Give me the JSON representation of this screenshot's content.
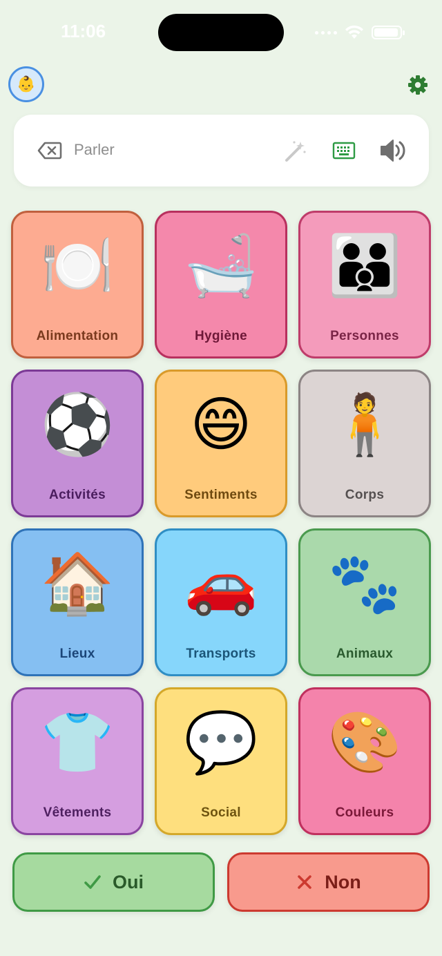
{
  "status": {
    "time": "11:06"
  },
  "header": {
    "avatar_emoji": "👶",
    "settings_icon": "gear-icon"
  },
  "speak_bar": {
    "placeholder": "Parler"
  },
  "categories": [
    {
      "label": "Alimentation",
      "emoji": "🍽️",
      "bg": "#fdab91",
      "border": "#c0603e",
      "text": "#7a3a1e"
    },
    {
      "label": "Hygiène",
      "emoji": "🛁",
      "bg": "#f488ab",
      "border": "#b8305e",
      "text": "#6e1838"
    },
    {
      "label": "Personnes",
      "emoji": "👪",
      "bg": "#f49bbb",
      "border": "#bf3c6a",
      "text": "#7a2446"
    },
    {
      "label": "Activités",
      "emoji": "⚽",
      "bg": "#c48ed6",
      "border": "#7c3a96",
      "text": "#4a1d5e"
    },
    {
      "label": "Sentiments",
      "emoji": "😄",
      "bg": "#ffcb7c",
      "border": "#d99a2a",
      "text": "#6e4a10"
    },
    {
      "label": "Corps",
      "emoji": "🧍",
      "bg": "#dcd4d3",
      "border": "#8c8484",
      "text": "#555050"
    },
    {
      "label": "Lieux",
      "emoji": "🏠",
      "bg": "#85bff2",
      "border": "#2f73b8",
      "text": "#1b4578"
    },
    {
      "label": "Transports",
      "emoji": "🚗",
      "bg": "#86d6fb",
      "border": "#2f8ec4",
      "text": "#1b5578"
    },
    {
      "label": "Animaux",
      "emoji": "🐾",
      "bg": "#aad9ab",
      "border": "#4a9a4e",
      "text": "#2a5a2e"
    },
    {
      "label": "Vêtements",
      "emoji": "👕",
      "bg": "#d59ee0",
      "border": "#8a45a0",
      "text": "#4e2060"
    },
    {
      "label": "Social",
      "emoji": "💬",
      "bg": "#fedf7e",
      "border": "#d4a82a",
      "text": "#6e5410"
    },
    {
      "label": "Couleurs",
      "emoji": "🎨",
      "bg": "#f483ab",
      "border": "#c0305e",
      "text": "#7a1838"
    }
  ],
  "answers": {
    "yes": {
      "label": "Oui",
      "bg": "#a6da9f",
      "border": "#3f9a45",
      "text": "#2a5a2a",
      "icon": "checkmark-icon"
    },
    "no": {
      "label": "Non",
      "bg": "#f89a8d",
      "border": "#cc3a30",
      "text": "#7a1e18",
      "icon": "x-icon"
    }
  }
}
